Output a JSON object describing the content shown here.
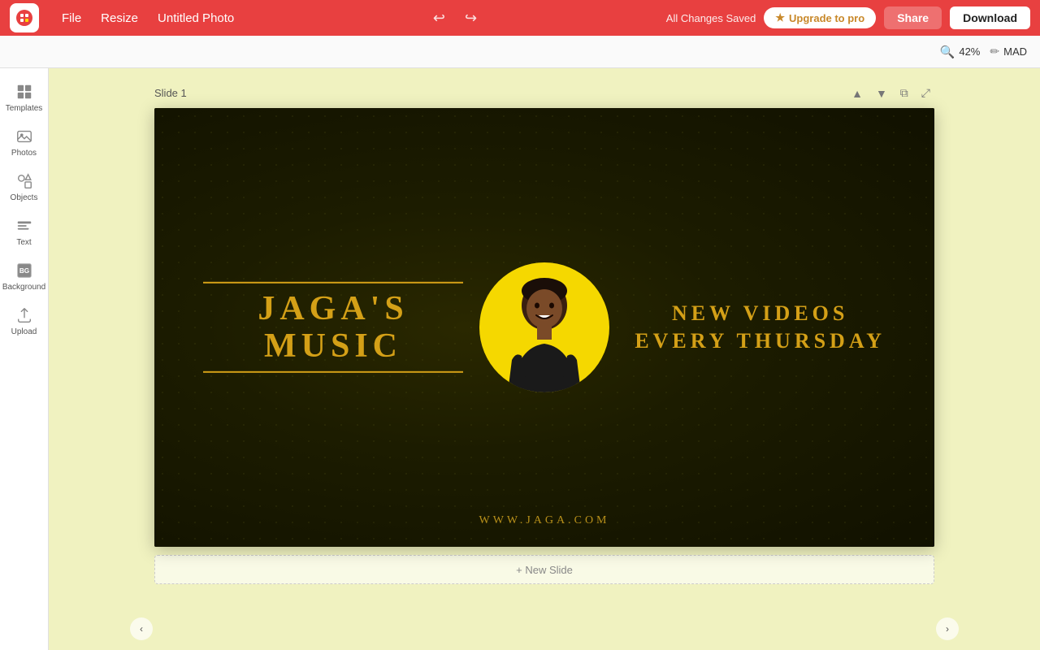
{
  "app": {
    "logo_alt": "Pixelied Logo",
    "title": "Untitled Photo"
  },
  "topbar": {
    "file_label": "File",
    "resize_label": "Resize",
    "doc_title": "Untitled Photo",
    "saved_text": "All Changes Saved",
    "upgrade_label": "Upgrade to pro",
    "share_label": "Share",
    "download_label": "Download"
  },
  "zoombar": {
    "zoom_value": "42%",
    "mad_label": "MAD"
  },
  "sidebar": {
    "items": [
      {
        "id": "templates",
        "label": "Templates",
        "icon": "grid"
      },
      {
        "id": "photos",
        "label": "Photos",
        "icon": "image"
      },
      {
        "id": "objects",
        "label": "Objects",
        "icon": "shapes"
      },
      {
        "id": "text",
        "label": "Text",
        "icon": "text"
      },
      {
        "id": "background",
        "label": "Background",
        "icon": "bg"
      },
      {
        "id": "upload",
        "label": "Upload",
        "icon": "upload"
      }
    ]
  },
  "slide": {
    "label": "Slide 1",
    "main_title": "JAGA'S   MUSIC",
    "right_line1": "NEW VIDEOS",
    "right_line2": "EVERY THURSDAY",
    "url": "WWW.JAGA.COM"
  },
  "canvas": {
    "new_slide_label": "+ New Slide"
  }
}
